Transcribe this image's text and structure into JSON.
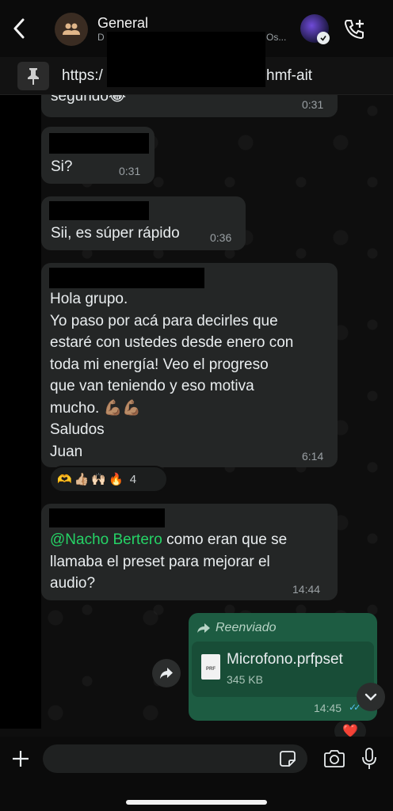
{
  "header": {
    "title": "General",
    "subtitle_start": "D",
    "subtitle_end": "Os..."
  },
  "pinned": {
    "text_start": "https:/",
    "text_end": "hmf-ait"
  },
  "messages": [
    {
      "text": "segundo😂",
      "time": "0:31"
    },
    {
      "text": "Si?",
      "time": "0:31"
    },
    {
      "text": "Sii, es súper rápido",
      "time": "0:36"
    },
    {
      "lines": [
        "Hola grupo.",
        "Yo paso por acá para decirles que",
        "estaré con ustedes desde enero con",
        "toda mi energía! Veo el progreso",
        "que van teniendo y eso motiva",
        "mucho. 💪🏽💪🏽",
        "Saludos",
        "Juan"
      ],
      "time": "6:14",
      "reactions": {
        "emojis": [
          "🫶",
          "👍🏼",
          "🙌🏻",
          "🔥"
        ],
        "count": "4"
      }
    },
    {
      "mention": "@Nacho Bertero",
      "text_after_mention": " como eran que se",
      "lines": [
        "llamaba el preset para mejorar el",
        "audio?"
      ],
      "time": "14:44"
    }
  ],
  "outgoing": {
    "forwarded_label": "Reenviado",
    "file_icon_label": "PRF",
    "file_name": "Microfono.prfpset",
    "file_size": "345 KB",
    "time": "14:45",
    "reaction": "❤️"
  },
  "composer": {
    "placeholder": ""
  }
}
